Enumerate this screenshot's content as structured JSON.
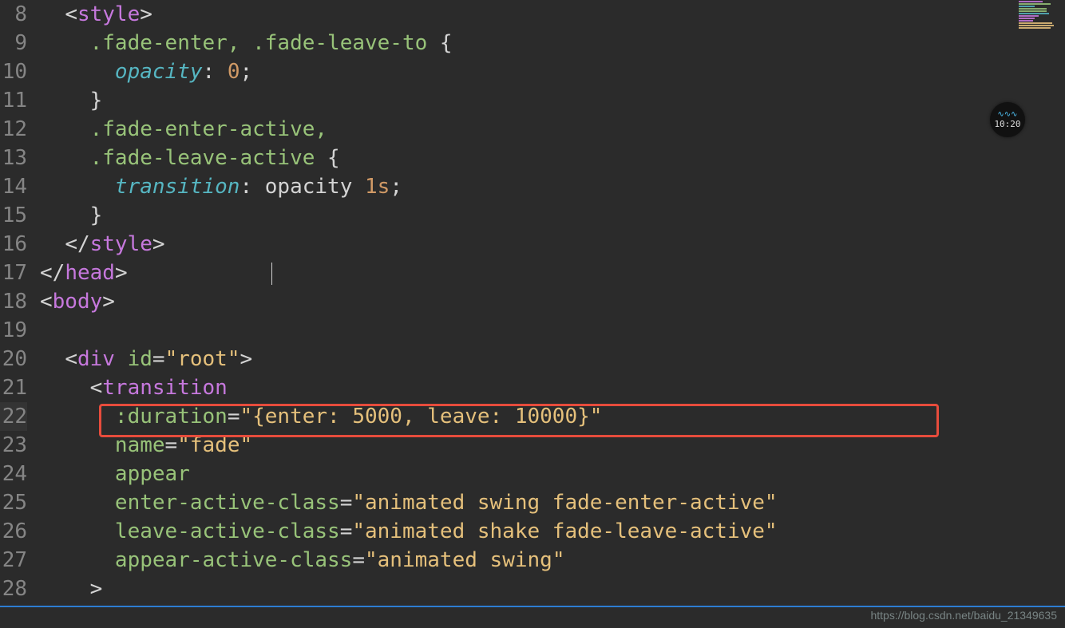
{
  "watermark": "https://blog.csdn.net/baidu_21349635",
  "badge_time": "10:20",
  "line_numbers": [
    "8",
    "9",
    "10",
    "11",
    "12",
    "13",
    "14",
    "15",
    "16",
    "17",
    "18",
    "19",
    "20",
    "21",
    "22",
    "23",
    "24",
    "25",
    "26",
    "27",
    "28"
  ],
  "highlighted_line_index": 14,
  "code": {
    "l8": {
      "open": "<",
      "tag": "style",
      "close": ">"
    },
    "l9": {
      "sel": ".fade-enter, .fade-leave-to",
      "brace": " {"
    },
    "l10": {
      "prop": "opacity",
      "colon": ": ",
      "val": "0",
      "semi": ";"
    },
    "l11": {
      "brace": "}"
    },
    "l12": {
      "sel": ".fade-enter-active,",
      "brace": ""
    },
    "l13": {
      "sel": ".fade-leave-active",
      "brace": " {"
    },
    "l14": {
      "prop": "transition",
      "colon": ": ",
      "val": "opacity ",
      "num": "1s",
      "semi": ";"
    },
    "l15": {
      "brace": "}"
    },
    "l16": {
      "open": "</",
      "tag": "style",
      "close": ">"
    },
    "l17": {
      "open": "</",
      "tag": "head",
      "close": ">"
    },
    "l18": {
      "open": "<",
      "tag": "body",
      "close": ">"
    },
    "l20": {
      "open": "<",
      "tag": "div",
      "sp": " ",
      "attr": "id",
      "eq": "=",
      "q": "\"",
      "val": "root",
      "q2": "\"",
      "close": ">"
    },
    "l21": {
      "open": "<",
      "tag": "transition"
    },
    "l22": {
      "attr": ":duration",
      "eq": "=",
      "q": "\"",
      "val": "{enter: 5000, leave: 10000}",
      "q2": "\""
    },
    "l23": {
      "attr": "name",
      "eq": "=",
      "q": "\"",
      "val": "fade",
      "q2": "\""
    },
    "l24": {
      "attr": "appear"
    },
    "l25": {
      "attr": "enter-active-class",
      "eq": "=",
      "q": "\"",
      "val": "animated swing fade-enter-active",
      "q2": "\""
    },
    "l26": {
      "attr": "leave-active-class",
      "eq": "=",
      "q": "\"",
      "val": "animated shake fade-leave-active",
      "q2": "\""
    },
    "l27": {
      "attr": "appear-active-class",
      "eq": "=",
      "q": "\"",
      "val": "animated swing",
      "q2": "\""
    },
    "l28": {
      "close": ">"
    }
  }
}
